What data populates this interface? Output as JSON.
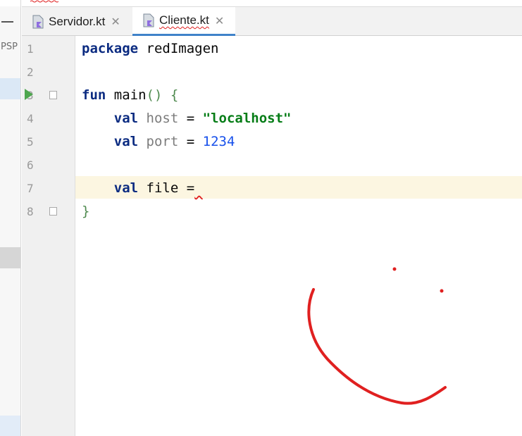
{
  "project_panel": {
    "label": "PSP"
  },
  "tabs": [
    {
      "label": "Servidor.kt",
      "close": "✕",
      "active": false
    },
    {
      "label": "Cliente.kt",
      "close": "✕",
      "active": true
    }
  ],
  "gutter": {
    "line_numbers": [
      "1",
      "2",
      "3",
      "4",
      "5",
      "6",
      "7",
      "8"
    ]
  },
  "code": {
    "line1": {
      "kw": "package",
      "rest": " redImagen"
    },
    "line3": {
      "kw": "fun",
      "name": " main",
      "parens": "()",
      "sp": " ",
      "brace": "{"
    },
    "line4": {
      "indent": "    ",
      "kw": "val",
      "sp1": " ",
      "param": "host",
      "eq": " = ",
      "str": "\"localhost\""
    },
    "line5": {
      "indent": "    ",
      "kw": "val",
      "sp1": " ",
      "param": "port",
      "eq": " = ",
      "num": "1234"
    },
    "line7": {
      "indent": "    ",
      "kw": "val",
      "rest": " file =",
      "err": " "
    },
    "line8": {
      "brace": "}"
    }
  },
  "colors": {
    "accent": "#4083c9",
    "current_line": "#fcf6e1",
    "keyword": "#0b2b81",
    "string": "#067d17",
    "number": "#1750eb",
    "annotation_ink": "#e02020"
  },
  "icons": {
    "file": "kotlin-file-icon",
    "run": "run-gutter-icon",
    "fold": "fold-marker-icon"
  }
}
